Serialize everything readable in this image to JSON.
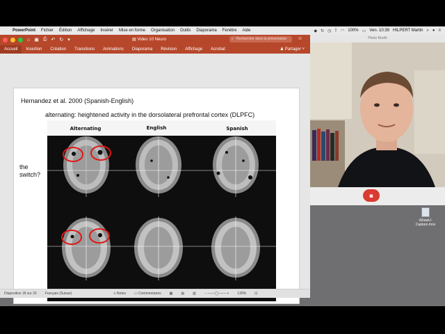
{
  "menubar": {
    "app_name": "PowerPoint",
    "items": [
      "Fichier",
      "Édition",
      "Affichage",
      "Insérer",
      "Mise en forme",
      "Organisation",
      "Outils",
      "Diaporama",
      "Fenêtre",
      "Aide"
    ],
    "battery": "100%",
    "clock": "Ven. 10:39",
    "user": "HILPERT Martin"
  },
  "powerpoint": {
    "document_title": "Video 10 Neuro",
    "search_placeholder": "Rechercher dans la présentation",
    "ribbon_tabs": [
      "Accueil",
      "Insertion",
      "Création",
      "Transitions",
      "Animations",
      "Diaporama",
      "Révision",
      "Affichage",
      "Acrobat"
    ],
    "share_label": "Partager",
    "status": {
      "slide_counter": "Diapositive 18 sur 20",
      "language": "Français (Suisse)",
      "notes": "Notes",
      "comments": "Commentaires",
      "zoom": "130%"
    }
  },
  "slide": {
    "reference": "Hernandez et al. 2000 (Spanish-English)",
    "subtitle": "alternating: heightened activity in the dorsolateral prefrontal cortex (DLPFC)",
    "question_line1": "the",
    "question_line2": "switch?",
    "figure": {
      "column_headers": [
        "Alternating",
        "English",
        "Spanish"
      ]
    }
  },
  "photo_booth": {
    "title": "Photo Booth"
  },
  "desktop_file": {
    "name_line1": "iShowU-",
    "name_line2": "Capture.mov"
  }
}
